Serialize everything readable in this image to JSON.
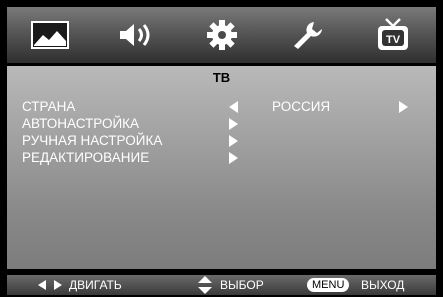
{
  "top_tabs": [
    {
      "icon": "picture-icon"
    },
    {
      "icon": "speaker-icon"
    },
    {
      "icon": "gear-icon"
    },
    {
      "icon": "wrench-icon"
    },
    {
      "icon": "tv-icon",
      "selected": true
    }
  ],
  "menu": {
    "title": "ТВ",
    "items": [
      {
        "label": "СТРАНА",
        "value": "РОССИЯ"
      },
      {
        "label": "АВТОНАСТРОЙКА"
      },
      {
        "label": "РУЧНАЯ НАСТРОЙКА"
      },
      {
        "label": "РЕДАКТИРОВАНИЕ"
      }
    ]
  },
  "footer": {
    "move": "ДВИГАТЬ",
    "select": "ВЫБОР",
    "menu_key": "MENU",
    "exit": "ВЫХОД"
  },
  "colors": {
    "accent": "#ffffff",
    "panel": "#a6a6a6"
  }
}
